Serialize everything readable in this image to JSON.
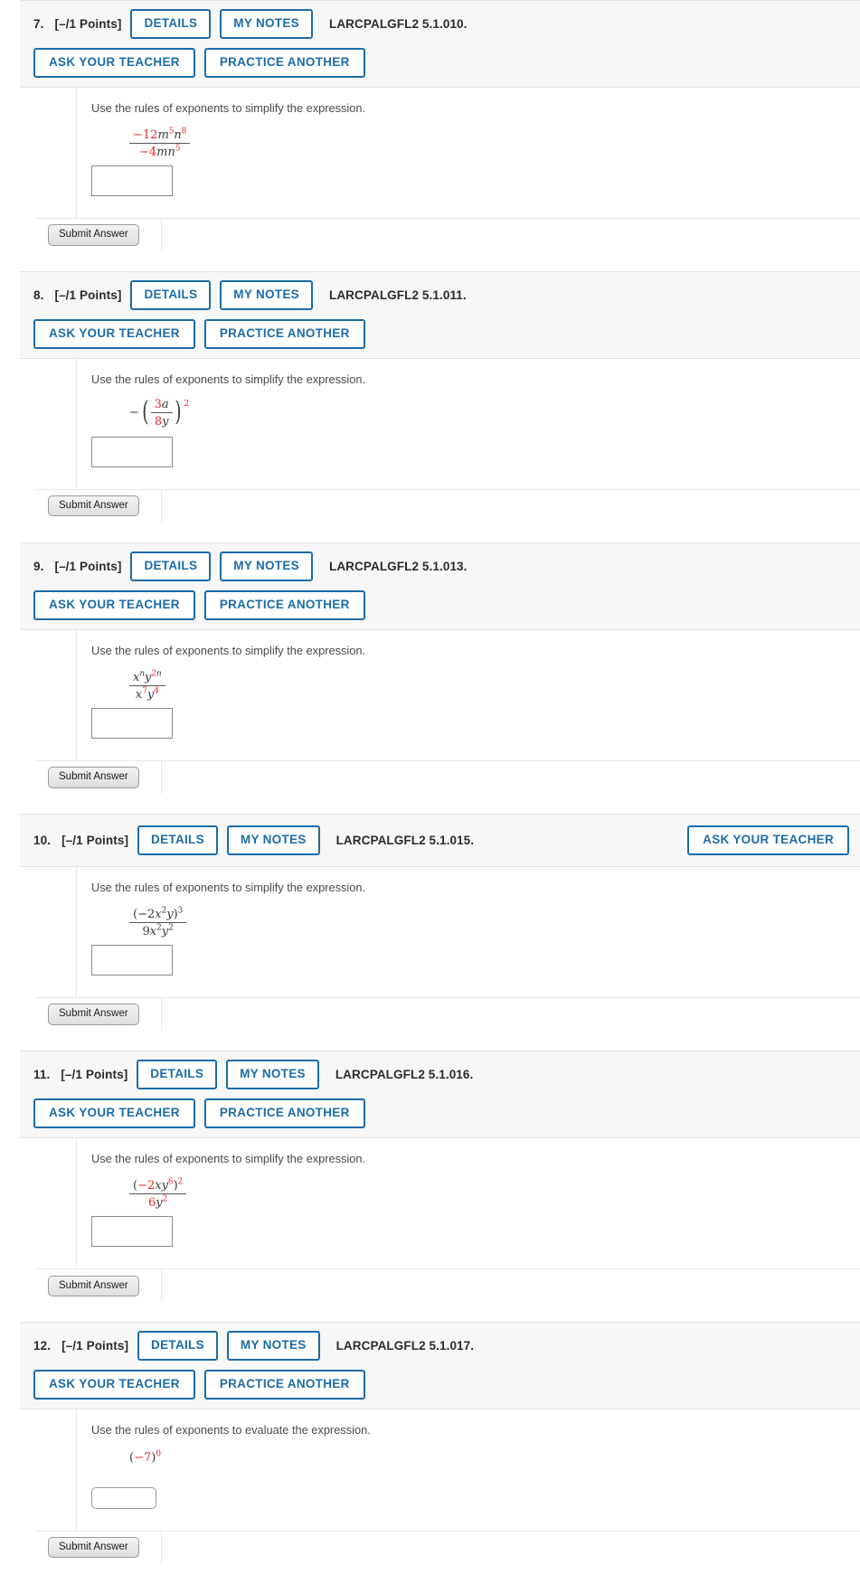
{
  "page": {
    "prompt_simplify": "Use the rules of exponents to simplify the expression.",
    "prompt_evaluate": "Use the rules of exponents to evaluate the expression.",
    "submit_label": "Submit Answer",
    "details_label": "DETAILS",
    "my_notes_label": "MY NOTES",
    "ask_teacher_label": "ASK YOUR TEACHER",
    "practice_another_label": "PRACTICE ANOTHER",
    "points_label": "[–/1 Points]",
    "answer_value": "",
    "colors": {
      "accent_blue": "#1b6ca8",
      "math_red": "#e8252a",
      "math_dark": "#3a3a3a",
      "header_bg": "#f7f7f7",
      "border": "#e3e3e3"
    }
  },
  "questions": [
    {
      "number": "7.",
      "points": "[–/1 Points]",
      "code": "LARCPALGFL2 5.1.010.",
      "prompt": "Use the rules of exponents to simplify the expression.",
      "expression_text": "(-12 m^5 n^8) / (-4 m n^5)",
      "layout": "two-row",
      "answer_box": "rect",
      "math": {
        "num": {
          "coef": "−12",
          "v1": "m",
          "e1": "5",
          "v2": "n",
          "e2": "8"
        },
        "den": {
          "coef": "−4",
          "v1": "m",
          "v2": "n",
          "e2": "5"
        }
      }
    },
    {
      "number": "8.",
      "points": "[–/1 Points]",
      "code": "LARCPALGFL2 5.1.011.",
      "prompt": "Use the rules of exponents to simplify the expression.",
      "expression_text": "-(3a / 8y)^2",
      "layout": "two-row",
      "answer_box": "rect",
      "math": {
        "lead": "−",
        "num": {
          "coef": "3",
          "v1": "a"
        },
        "den": {
          "coef": "8",
          "v1": "y"
        },
        "outer_exp": "2"
      }
    },
    {
      "number": "9.",
      "points": "[–/1 Points]",
      "code": "LARCPALGFL2 5.1.013.",
      "prompt": "Use the rules of exponents to simplify the expression.",
      "expression_text": "(x^n y^{2n}) / (x^7 y^4)",
      "layout": "two-row",
      "answer_box": "rect",
      "math": {
        "num": {
          "v1": "x",
          "e1": "n",
          "v2": "y",
          "e2coef": "2",
          "e2var": "n"
        },
        "den": {
          "v1": "x",
          "e1": "7",
          "v2": "y",
          "e2": "4"
        }
      }
    },
    {
      "number": "10.",
      "points": "[–/1 Points]",
      "code": "LARCPALGFL2 5.1.015.",
      "prompt": "Use the rules of exponents to simplify the expression.",
      "expression_text": "(-2x^2 y)^3 / (9x^2 y^2)",
      "layout": "one-row",
      "answer_box": "rect",
      "math": {
        "num": {
          "coef": "−2",
          "v1": "x",
          "e1": "2",
          "v2": "y",
          "outer": "3"
        },
        "den": {
          "coef": "9",
          "v1": "x",
          "e1": "2",
          "v2": "y",
          "e2": "2"
        }
      }
    },
    {
      "number": "11.",
      "points": "[–/1 Points]",
      "code": "LARCPALGFL2 5.1.016.",
      "prompt": "Use the rules of exponents to simplify the expression.",
      "expression_text": "(-2xy^6)^2 / (6y^2)",
      "layout": "two-row",
      "answer_box": "rect",
      "math": {
        "num": {
          "coef": "−2",
          "v1": "x",
          "v2": "y",
          "e2": "6",
          "outer": "2"
        },
        "den": {
          "coef": "6",
          "v1": "y",
          "e1": "2"
        }
      }
    },
    {
      "number": "12.",
      "points": "[–/1 Points]",
      "code": "LARCPALGFL2 5.1.017.",
      "prompt": "Use the rules of exponents to evaluate the expression.",
      "expression_text": "(-7)^0",
      "layout": "two-row",
      "answer_box": "rounded",
      "math": {
        "base": "−7",
        "exp": "0"
      }
    }
  ]
}
